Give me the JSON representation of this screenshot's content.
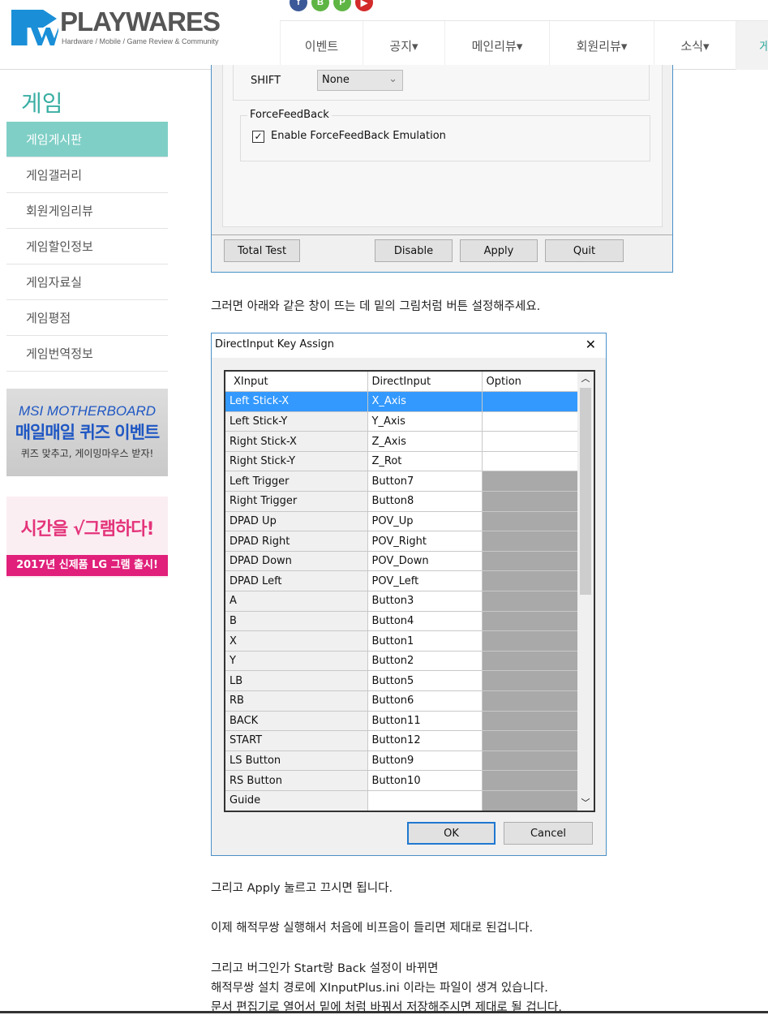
{
  "header": {
    "logo_text": "PLAYWARES",
    "logo_sub": "Hardware / Mobile / Game Review & Community",
    "social": [
      {
        "icon": "facebook-icon",
        "label": "f",
        "color": "#3b5998"
      },
      {
        "icon": "blog-icon",
        "label": "B",
        "color": "#5fb544"
      },
      {
        "icon": "post-icon",
        "label": "P",
        "color": "#5fb544"
      },
      {
        "icon": "youtube-icon",
        "label": "▶",
        "color": "#d32a2a"
      }
    ],
    "nav": [
      "이벤트",
      "공지▾",
      "메인리뷰▾",
      "회원리뷰▾",
      "소식▾",
      "게"
    ]
  },
  "sidebar": {
    "title": "게임",
    "items": [
      "게임게시판",
      "게임갤러리",
      "회원게임리뷰",
      "게임할인정보",
      "게임자료실",
      "게임평점",
      "게임번역정보"
    ],
    "banner1": {
      "l1": "MSI MOTHERBOARD",
      "l2": "매일매일 퀴즈 이벤트",
      "l3": "퀴즈 맞추고, 게이밍마우스 받자!"
    },
    "banner2": {
      "l1": "시간을 √그램하다!",
      "l2": "2017년 신제품 LG 그램 출시!"
    }
  },
  "dialog1": {
    "shift_label": "SHIFT",
    "shift_value": "None",
    "group": "ForceFeedBack",
    "checkbox": "Enable ForceFeedBack Emulation",
    "checked": true,
    "buttons": {
      "total": "Total Test",
      "disable": "Disable",
      "apply": "Apply",
      "quit": "Quit"
    }
  },
  "text1": "그러면 아래와 같은 창이 뜨는 데 밑의 그림처럼 버튼 설정해주세요.",
  "dialog2": {
    "title": "DirectInput Key Assign",
    "close": "✕",
    "headers": [
      "XInput",
      "DirectInput",
      "Option"
    ],
    "rows": [
      [
        "Left Stick-X",
        "X_Axis",
        ""
      ],
      [
        "Left Stick-Y",
        "Y_Axis",
        ""
      ],
      [
        "Right Stick-X",
        "Z_Axis",
        ""
      ],
      [
        "Right Stick-Y",
        "Z_Rot",
        ""
      ],
      [
        "Left Trigger",
        "Button7",
        ""
      ],
      [
        "Right Trigger",
        "Button8",
        ""
      ],
      [
        "DPAD Up",
        "POV_Up",
        ""
      ],
      [
        "DPAD Right",
        "POV_Right",
        ""
      ],
      [
        "DPAD Down",
        "POV_Down",
        ""
      ],
      [
        "DPAD Left",
        "POV_Left",
        ""
      ],
      [
        "A",
        "Button3",
        ""
      ],
      [
        "B",
        "Button4",
        ""
      ],
      [
        "X",
        "Button1",
        ""
      ],
      [
        "Y",
        "Button2",
        ""
      ],
      [
        "LB",
        "Button5",
        ""
      ],
      [
        "RB",
        "Button6",
        ""
      ],
      [
        "BACK",
        "Button11",
        ""
      ],
      [
        "START",
        "Button12",
        ""
      ],
      [
        "LS Button",
        "Button9",
        ""
      ],
      [
        "RS Button",
        "Button10",
        ""
      ],
      [
        "Guide",
        "",
        ""
      ]
    ],
    "selected_row": 0,
    "ok": "OK",
    "cancel": "Cancel"
  },
  "text2": "그리고 Apply 눌르고 끄시면 됩니다.",
  "text3": "이제 해적무쌍 실행해서 처음에 비프음이 들리면 제대로 된겁니다.",
  "text4": "그리고 버그인가 Start랑 Back 설정이 바뀌면",
  "text5": "해적무쌍 설치 경로에 XInputPlus.ini 이라는 파일이 생겨 있습니다.",
  "text6": "문서 편집기로 열어서 밑에 처럼 바꿔서 저장해주시면 제대로 될 겁니다."
}
